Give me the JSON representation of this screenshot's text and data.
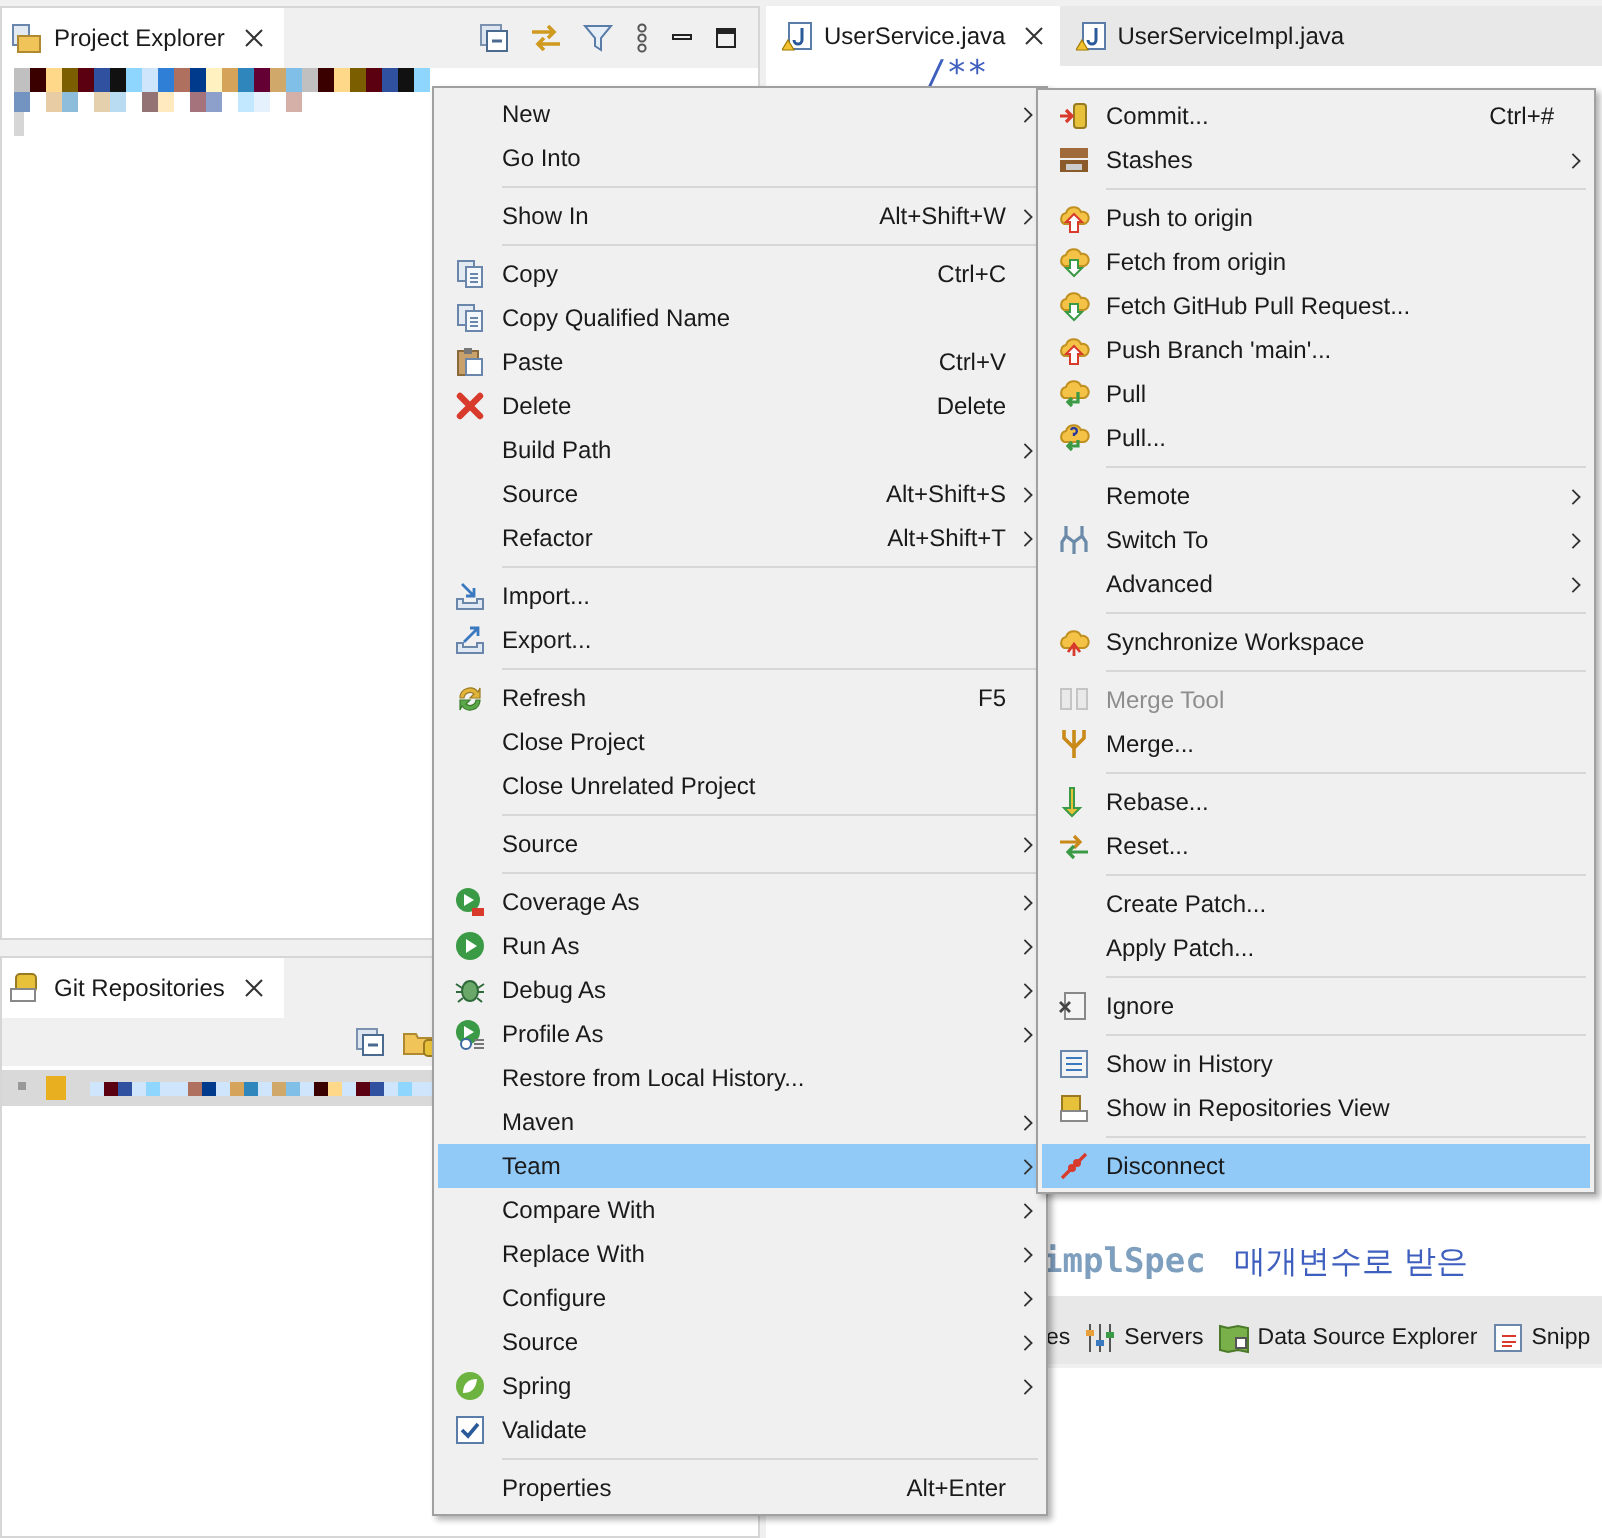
{
  "project_explorer": {
    "title": "Project Explorer"
  },
  "git_repositories": {
    "title": "Git Repositories"
  },
  "editor": {
    "tabs": [
      {
        "label": "UserService.java",
        "selected": true
      },
      {
        "label": "UserServiceImpl.java",
        "selected": false
      }
    ],
    "comment_start": "/**",
    "tag": "implSpec",
    "comment_text": "매개변수로 받은"
  },
  "bottom_tabs": [
    {
      "label": "es"
    },
    {
      "label": "Servers"
    },
    {
      "label": "Data Source Explorer"
    },
    {
      "label": "Snipp"
    }
  ],
  "context_menu": [
    {
      "kind": "item",
      "label": "New",
      "submenu": true,
      "selected": false
    },
    {
      "kind": "item",
      "label": "Go Into",
      "submenu": false,
      "selected": false
    },
    {
      "kind": "separator"
    },
    {
      "kind": "item",
      "label": "Show In",
      "shortcut": "Alt+Shift+W",
      "submenu": true,
      "selected": false
    },
    {
      "kind": "separator"
    },
    {
      "kind": "item",
      "label": "Copy",
      "shortcut": "Ctrl+C",
      "submenu": false,
      "selected": false
    },
    {
      "kind": "item",
      "label": "Copy Qualified Name",
      "submenu": false,
      "selected": false
    },
    {
      "kind": "item",
      "label": "Paste",
      "shortcut": "Ctrl+V",
      "submenu": false,
      "selected": false
    },
    {
      "kind": "item",
      "label": "Delete",
      "shortcut": "Delete",
      "submenu": false,
      "selected": false
    },
    {
      "kind": "item",
      "label": "Build Path",
      "submenu": true,
      "selected": false
    },
    {
      "kind": "item",
      "label": "Source",
      "shortcut": "Alt+Shift+S",
      "submenu": true,
      "selected": false
    },
    {
      "kind": "item",
      "label": "Refactor",
      "shortcut": "Alt+Shift+T",
      "submenu": true,
      "selected": false
    },
    {
      "kind": "separator"
    },
    {
      "kind": "item",
      "label": "Import...",
      "submenu": false,
      "selected": false
    },
    {
      "kind": "item",
      "label": "Export...",
      "submenu": false,
      "selected": false
    },
    {
      "kind": "separator"
    },
    {
      "kind": "item",
      "label": "Refresh",
      "shortcut": "F5",
      "submenu": false,
      "selected": false
    },
    {
      "kind": "item",
      "label": "Close Project",
      "submenu": false,
      "selected": false
    },
    {
      "kind": "item",
      "label": "Close Unrelated Project",
      "submenu": false,
      "selected": false
    },
    {
      "kind": "separator"
    },
    {
      "kind": "item",
      "label": "Source",
      "submenu": true,
      "selected": false
    },
    {
      "kind": "separator"
    },
    {
      "kind": "item",
      "label": "Coverage As",
      "submenu": true,
      "selected": false
    },
    {
      "kind": "item",
      "label": "Run As",
      "submenu": true,
      "selected": false
    },
    {
      "kind": "item",
      "label": "Debug As",
      "submenu": true,
      "selected": false
    },
    {
      "kind": "item",
      "label": "Profile As",
      "submenu": true,
      "selected": false
    },
    {
      "kind": "item",
      "label": "Restore from Local History...",
      "submenu": false,
      "selected": false
    },
    {
      "kind": "item",
      "label": "Maven",
      "submenu": true,
      "selected": false
    },
    {
      "kind": "item",
      "label": "Team",
      "submenu": true,
      "selected": true
    },
    {
      "kind": "item",
      "label": "Compare With",
      "submenu": true,
      "selected": false
    },
    {
      "kind": "item",
      "label": "Replace With",
      "submenu": true,
      "selected": false
    },
    {
      "kind": "item",
      "label": "Configure",
      "submenu": true,
      "selected": false
    },
    {
      "kind": "item",
      "label": "Source",
      "submenu": true,
      "selected": false
    },
    {
      "kind": "item",
      "label": "Spring",
      "submenu": true,
      "selected": false
    },
    {
      "kind": "item",
      "label": "Validate",
      "submenu": false,
      "selected": false
    },
    {
      "kind": "separator"
    },
    {
      "kind": "item",
      "label": "Properties",
      "shortcut": "Alt+Enter",
      "submenu": false,
      "selected": false
    }
  ],
  "team_submenu": [
    {
      "kind": "item",
      "label": "Commit...",
      "shortcut": "Ctrl+#",
      "submenu": false,
      "selected": false,
      "disabled": false
    },
    {
      "kind": "item",
      "label": "Stashes",
      "submenu": true,
      "selected": false,
      "disabled": false
    },
    {
      "kind": "separator"
    },
    {
      "kind": "item",
      "label": "Push to origin",
      "submenu": false,
      "selected": false,
      "disabled": false
    },
    {
      "kind": "item",
      "label": "Fetch from origin",
      "submenu": false,
      "selected": false,
      "disabled": false
    },
    {
      "kind": "item",
      "label": "Fetch GitHub Pull Request...",
      "submenu": false,
      "selected": false,
      "disabled": false
    },
    {
      "kind": "item",
      "label": "Push Branch 'main'...",
      "submenu": false,
      "selected": false,
      "disabled": false
    },
    {
      "kind": "item",
      "label": "Pull",
      "submenu": false,
      "selected": false,
      "disabled": false
    },
    {
      "kind": "item",
      "label": "Pull...",
      "submenu": false,
      "selected": false,
      "disabled": false
    },
    {
      "kind": "separator"
    },
    {
      "kind": "item",
      "label": "Remote",
      "submenu": true,
      "selected": false,
      "disabled": false
    },
    {
      "kind": "item",
      "label": "Switch To",
      "submenu": true,
      "selected": false,
      "disabled": false
    },
    {
      "kind": "item",
      "label": "Advanced",
      "submenu": true,
      "selected": false,
      "disabled": false
    },
    {
      "kind": "separator"
    },
    {
      "kind": "item",
      "label": "Synchronize Workspace",
      "submenu": false,
      "selected": false,
      "disabled": false
    },
    {
      "kind": "separator"
    },
    {
      "kind": "item",
      "label": "Merge Tool",
      "submenu": false,
      "selected": false,
      "disabled": true
    },
    {
      "kind": "item",
      "label": "Merge...",
      "submenu": false,
      "selected": false,
      "disabled": false
    },
    {
      "kind": "separator"
    },
    {
      "kind": "item",
      "label": "Rebase...",
      "submenu": false,
      "selected": false,
      "disabled": false
    },
    {
      "kind": "item",
      "label": "Reset...",
      "submenu": false,
      "selected": false,
      "disabled": false
    },
    {
      "kind": "separator"
    },
    {
      "kind": "item",
      "label": "Create Patch...",
      "submenu": false,
      "selected": false,
      "disabled": false
    },
    {
      "kind": "item",
      "label": "Apply Patch...",
      "submenu": false,
      "selected": false,
      "disabled": false
    },
    {
      "kind": "separator"
    },
    {
      "kind": "item",
      "label": "Ignore",
      "submenu": false,
      "selected": false,
      "disabled": false
    },
    {
      "kind": "separator"
    },
    {
      "kind": "item",
      "label": "Show in History",
      "submenu": false,
      "selected": false,
      "disabled": false
    },
    {
      "kind": "item",
      "label": "Show in Repositories View",
      "submenu": false,
      "selected": false,
      "disabled": false
    },
    {
      "kind": "separator"
    },
    {
      "kind": "item",
      "label": "Disconnect",
      "submenu": false,
      "selected": true,
      "disabled": false
    }
  ]
}
